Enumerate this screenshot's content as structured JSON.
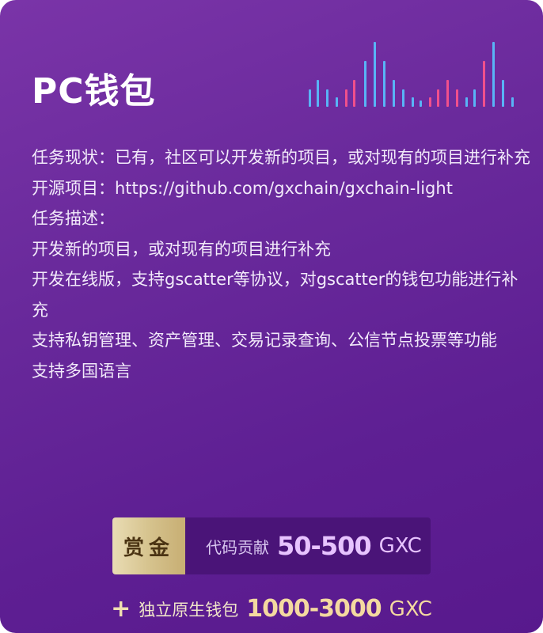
{
  "title": "PC钱包",
  "equalizer": {
    "colors": {
      "blue": "#59b4f6",
      "pink": "#f0508c"
    }
  },
  "task": {
    "status_label": "任务现状：",
    "status_value": "已有，社区可以开发新的项目，或对现有的项目进行补充",
    "source_label": "开源项目：",
    "source_value": "https://github.com/gxchain/gxchain-light",
    "desc_label": "任务描述：",
    "desc_lines": [
      "开发新的项目，或对现有的项目进行补充",
      "开发在线版，支持gscatter等协议，对gscatter的钱包功能进行补充",
      "支持私钥管理、资产管理、交易记录查询、公信节点投票等功能",
      "支持多国语言"
    ]
  },
  "bounty": {
    "tag": "赏金",
    "text": "代码贡献",
    "amount": "50-500",
    "unit": "GXC"
  },
  "extra": {
    "plus": "+",
    "text": "独立原生钱包",
    "amount": "1000-3000",
    "unit": "GXC"
  }
}
